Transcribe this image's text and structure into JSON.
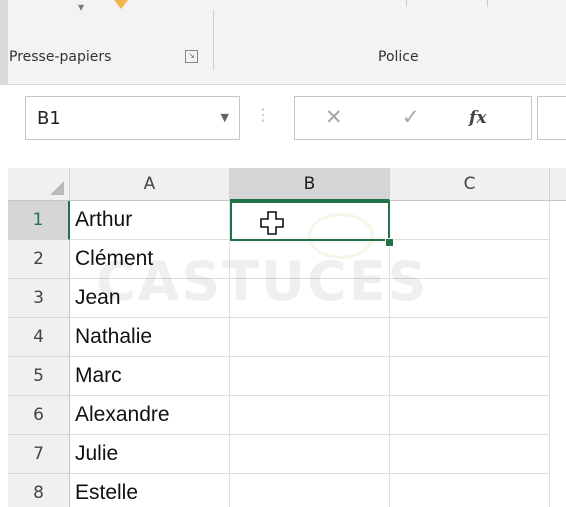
{
  "ribbon": {
    "clipboard_group_label": "Presse-papiers",
    "font_group_label": "Police"
  },
  "formula_bar": {
    "name_box_value": "B1",
    "cancel_symbol": "✕",
    "enter_symbol": "✓",
    "function_symbol": "fx",
    "formula_value": ""
  },
  "grid": {
    "columns": [
      "A",
      "B",
      "C"
    ],
    "selected_column": "B",
    "rows": [
      {
        "number": "1",
        "a": "Arthur",
        "b": "",
        "c": ""
      },
      {
        "number": "2",
        "a": "Clément",
        "b": "",
        "c": ""
      },
      {
        "number": "3",
        "a": "Jean",
        "b": "",
        "c": ""
      },
      {
        "number": "4",
        "a": "Nathalie",
        "b": "",
        "c": ""
      },
      {
        "number": "5",
        "a": "Marc",
        "b": "",
        "c": ""
      },
      {
        "number": "6",
        "a": "Alexandre",
        "b": "",
        "c": ""
      },
      {
        "number": "7",
        "a": "Julie",
        "b": "",
        "c": ""
      },
      {
        "number": "8",
        "a": "Estelle",
        "b": "",
        "c": ""
      }
    ],
    "active_cell": "B1"
  },
  "watermark": {
    "text": "CASTUCES"
  },
  "colors": {
    "accent": "#217346",
    "header_bg": "#f0f0f0",
    "selected_header_bg": "#d6d6d6"
  },
  "icons": {
    "cursor": "cross-cursor-icon",
    "name_box_dropdown": "chevron-down-icon",
    "dialog_launcher": "dialog-launcher-icon"
  }
}
